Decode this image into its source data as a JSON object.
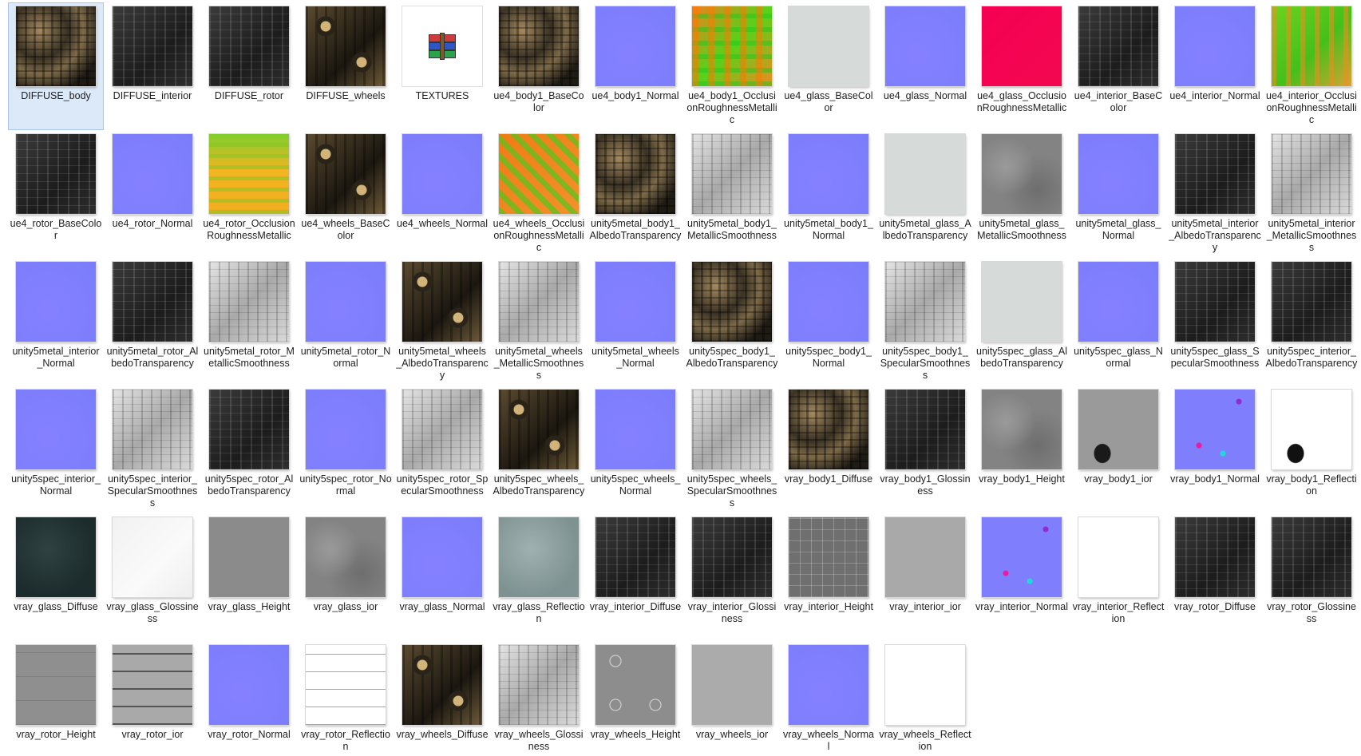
{
  "items": [
    {
      "label": "DIFFUSE_body",
      "icon": "texture-thumbnail",
      "selected": true
    },
    {
      "label": "DIFFUSE_interior",
      "icon": "texture-thumbnail"
    },
    {
      "label": "DIFFUSE_rotor",
      "icon": "texture-thumbnail"
    },
    {
      "label": "DIFFUSE_wheels",
      "icon": "texture-thumbnail"
    },
    {
      "label": "TEXTURES",
      "icon": "winrar-archive-icon"
    },
    {
      "label": "ue4_body1_BaseColor",
      "icon": "texture-thumbnail"
    },
    {
      "label": "ue4_body1_Normal",
      "icon": "texture-thumbnail"
    },
    {
      "label": "ue4_body1_OcclusionRoughnessMetallic",
      "icon": "texture-thumbnail"
    },
    {
      "label": "ue4_glass_BaseColor",
      "icon": "texture-thumbnail"
    },
    {
      "label": "ue4_glass_Normal",
      "icon": "texture-thumbnail"
    },
    {
      "label": "ue4_glass_OcclusionRoughnessMetallic",
      "icon": "texture-thumbnail"
    },
    {
      "label": "ue4_interior_BaseColor",
      "icon": "texture-thumbnail"
    },
    {
      "label": "ue4_interior_Normal",
      "icon": "texture-thumbnail"
    },
    {
      "label": "ue4_interior_OcclusionRoughnessMetallic",
      "icon": "texture-thumbnail"
    },
    {
      "label": "ue4_rotor_BaseColor",
      "icon": "texture-thumbnail"
    },
    {
      "label": "ue4_rotor_Normal",
      "icon": "texture-thumbnail"
    },
    {
      "label": "ue4_rotor_OcclusionRoughnessMetallic",
      "icon": "texture-thumbnail"
    },
    {
      "label": "ue4_wheels_BaseColor",
      "icon": "texture-thumbnail"
    },
    {
      "label": "ue4_wheels_Normal",
      "icon": "texture-thumbnail"
    },
    {
      "label": "ue4_wheels_OcclusionRoughnessMetallic",
      "icon": "texture-thumbnail"
    },
    {
      "label": "unity5metal_body1_AlbedoTransparency",
      "icon": "texture-thumbnail"
    },
    {
      "label": "unity5metal_body1_MetallicSmoothness",
      "icon": "texture-thumbnail"
    },
    {
      "label": "unity5metal_body1_Normal",
      "icon": "texture-thumbnail"
    },
    {
      "label": "unity5metal_glass_AlbedoTransparency",
      "icon": "texture-thumbnail"
    },
    {
      "label": "unity5metal_glass_MetallicSmoothness",
      "icon": "texture-thumbnail"
    },
    {
      "label": "unity5metal_glass_Normal",
      "icon": "texture-thumbnail"
    },
    {
      "label": "unity5metal_interior_AlbedoTransparency",
      "icon": "texture-thumbnail"
    },
    {
      "label": "unity5metal_interior_MetallicSmoothness",
      "icon": "texture-thumbnail"
    },
    {
      "label": "unity5metal_interior_Normal",
      "icon": "texture-thumbnail"
    },
    {
      "label": "unity5metal_rotor_AlbedoTransparency",
      "icon": "texture-thumbnail"
    },
    {
      "label": "unity5metal_rotor_MetallicSmoothness",
      "icon": "texture-thumbnail"
    },
    {
      "label": "unity5metal_rotor_Normal",
      "icon": "texture-thumbnail"
    },
    {
      "label": "unity5metal_wheels_AlbedoTransparency",
      "icon": "texture-thumbnail"
    },
    {
      "label": "unity5metal_wheels_MetallicSmoothness",
      "icon": "texture-thumbnail"
    },
    {
      "label": "unity5metal_wheels_Normal",
      "icon": "texture-thumbnail"
    },
    {
      "label": "unity5spec_body1_AlbedoTransparency",
      "icon": "texture-thumbnail"
    },
    {
      "label": "unity5spec_body1_Normal",
      "icon": "texture-thumbnail"
    },
    {
      "label": "unity5spec_body1_SpecularSmoothness",
      "icon": "texture-thumbnail"
    },
    {
      "label": "unity5spec_glass_AlbedoTransparency",
      "icon": "texture-thumbnail"
    },
    {
      "label": "unity5spec_glass_Normal",
      "icon": "texture-thumbnail"
    },
    {
      "label": "unity5spec_glass_SpecularSmoothness",
      "icon": "texture-thumbnail"
    },
    {
      "label": "unity5spec_interior_AlbedoTransparency",
      "icon": "texture-thumbnail"
    },
    {
      "label": "unity5spec_interior_Normal",
      "icon": "texture-thumbnail"
    },
    {
      "label": "unity5spec_interior_SpecularSmoothness",
      "icon": "texture-thumbnail"
    },
    {
      "label": "unity5spec_rotor_AlbedoTransparency",
      "icon": "texture-thumbnail"
    },
    {
      "label": "unity5spec_rotor_Normal",
      "icon": "texture-thumbnail"
    },
    {
      "label": "unity5spec_rotor_SpecularSmoothness",
      "icon": "texture-thumbnail"
    },
    {
      "label": "unity5spec_wheels_AlbedoTransparency",
      "icon": "texture-thumbnail"
    },
    {
      "label": "unity5spec_wheels_Normal",
      "icon": "texture-thumbnail"
    },
    {
      "label": "unity5spec_wheels_SpecularSmoothness",
      "icon": "texture-thumbnail"
    },
    {
      "label": "vray_body1_Diffuse",
      "icon": "texture-thumbnail"
    },
    {
      "label": "vray_body1_Glossiness",
      "icon": "texture-thumbnail"
    },
    {
      "label": "vray_body1_Height",
      "icon": "texture-thumbnail"
    },
    {
      "label": "vray_body1_ior",
      "icon": "texture-thumbnail"
    },
    {
      "label": "vray_body1_Normal",
      "icon": "texture-thumbnail"
    },
    {
      "label": "vray_body1_Reflection",
      "icon": "texture-thumbnail"
    },
    {
      "label": "vray_glass_Diffuse",
      "icon": "texture-thumbnail"
    },
    {
      "label": "vray_glass_Glossiness",
      "icon": "texture-thumbnail"
    },
    {
      "label": "vray_glass_Height",
      "icon": "texture-thumbnail"
    },
    {
      "label": "vray_glass_ior",
      "icon": "texture-thumbnail"
    },
    {
      "label": "vray_glass_Normal",
      "icon": "texture-thumbnail"
    },
    {
      "label": "vray_glass_Reflection",
      "icon": "texture-thumbnail"
    },
    {
      "label": "vray_interior_Diffuse",
      "icon": "texture-thumbnail"
    },
    {
      "label": "vray_interior_Glossiness",
      "icon": "texture-thumbnail"
    },
    {
      "label": "vray_interior_Height",
      "icon": "texture-thumbnail"
    },
    {
      "label": "vray_interior_ior",
      "icon": "texture-thumbnail"
    },
    {
      "label": "vray_interior_Normal",
      "icon": "texture-thumbnail"
    },
    {
      "label": "vray_interior_Reflection",
      "icon": "texture-thumbnail"
    },
    {
      "label": "vray_rotor_Diffuse",
      "icon": "texture-thumbnail"
    },
    {
      "label": "vray_rotor_Glossiness",
      "icon": "texture-thumbnail"
    },
    {
      "label": "vray_rotor_Height",
      "icon": "texture-thumbnail"
    },
    {
      "label": "vray_rotor_ior",
      "icon": "texture-thumbnail"
    },
    {
      "label": "vray_rotor_Normal",
      "icon": "texture-thumbnail"
    },
    {
      "label": "vray_rotor_Reflection",
      "icon": "texture-thumbnail"
    },
    {
      "label": "vray_wheels_Diffuse",
      "icon": "texture-thumbnail"
    },
    {
      "label": "vray_wheels_Glossiness",
      "icon": "texture-thumbnail"
    },
    {
      "label": "vray_wheels_Height",
      "icon": "texture-thumbnail"
    },
    {
      "label": "vray_wheels_ior",
      "icon": "texture-thumbnail"
    },
    {
      "label": "vray_wheels_Normal",
      "icon": "texture-thumbnail"
    },
    {
      "label": "vray_wheels_Reflection",
      "icon": "texture-thumbnail"
    }
  ],
  "colors": {
    "selection_bg": "#dce9f9",
    "selection_border": "#a9c6ec",
    "normal_map": "#7f7ffe"
  }
}
